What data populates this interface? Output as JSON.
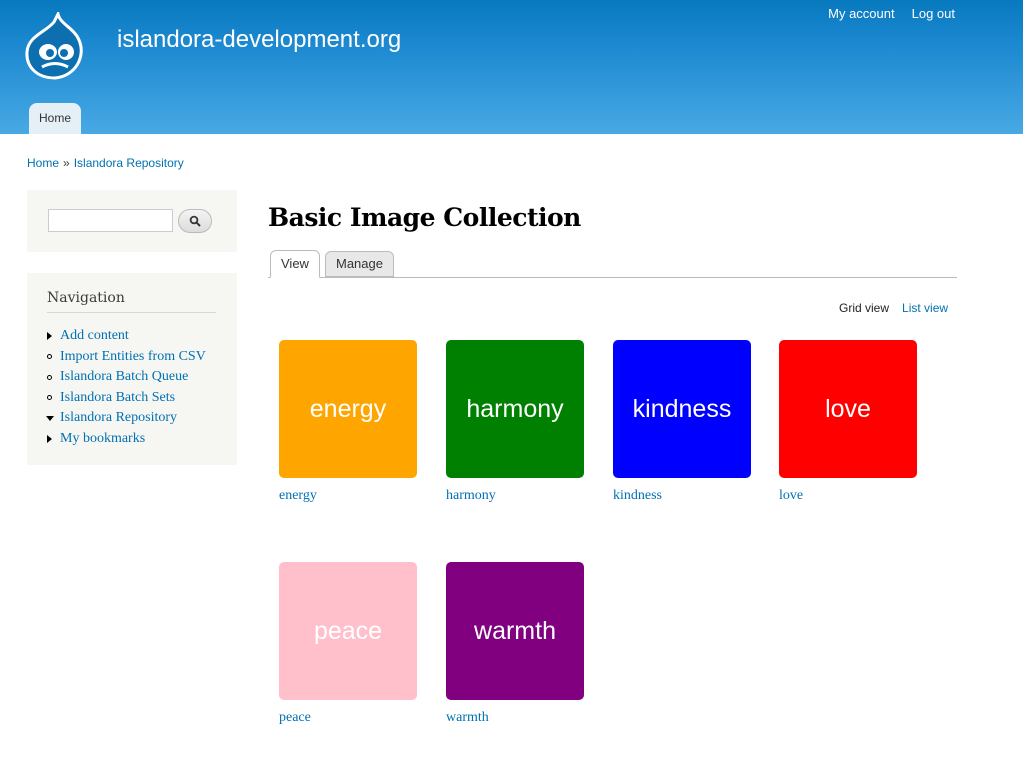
{
  "site": {
    "name": "islandora-development.org",
    "secondary_menu": [
      "My account",
      "Log out"
    ],
    "main_menu": [
      "Home"
    ]
  },
  "breadcrumb": {
    "items": [
      "Home",
      "Islandora Repository"
    ],
    "separator": "»"
  },
  "search": {
    "value": "",
    "button_icon": "search-icon"
  },
  "navigation": {
    "title": "Navigation",
    "items": [
      {
        "label": "Add content",
        "marker": "collapsed"
      },
      {
        "label": "Import Entities from CSV",
        "marker": "leaf"
      },
      {
        "label": "Islandora Batch Queue",
        "marker": "leaf"
      },
      {
        "label": "Islandora Batch Sets",
        "marker": "leaf"
      },
      {
        "label": "Islandora Repository",
        "marker": "expanded"
      },
      {
        "label": "My bookmarks",
        "marker": "collapsed"
      }
    ]
  },
  "page": {
    "title": "Basic Image Collection",
    "tabs": [
      "View",
      "Manage"
    ],
    "active_tab": "View",
    "view_modes": {
      "active": "Grid view",
      "other": "List view"
    }
  },
  "gallery": [
    {
      "label": "energy",
      "color": "#ffa500"
    },
    {
      "label": "harmony",
      "color": "#008000"
    },
    {
      "label": "kindness",
      "color": "#0000ff"
    },
    {
      "label": "love",
      "color": "#ff0000"
    },
    {
      "label": "peace",
      "color": "#ffc0cb"
    },
    {
      "label": "warmth",
      "color": "#800080"
    }
  ],
  "colors": {
    "link": "#0071b3",
    "header_top": "#0779bf",
    "header_bottom": "#48a9e4"
  }
}
